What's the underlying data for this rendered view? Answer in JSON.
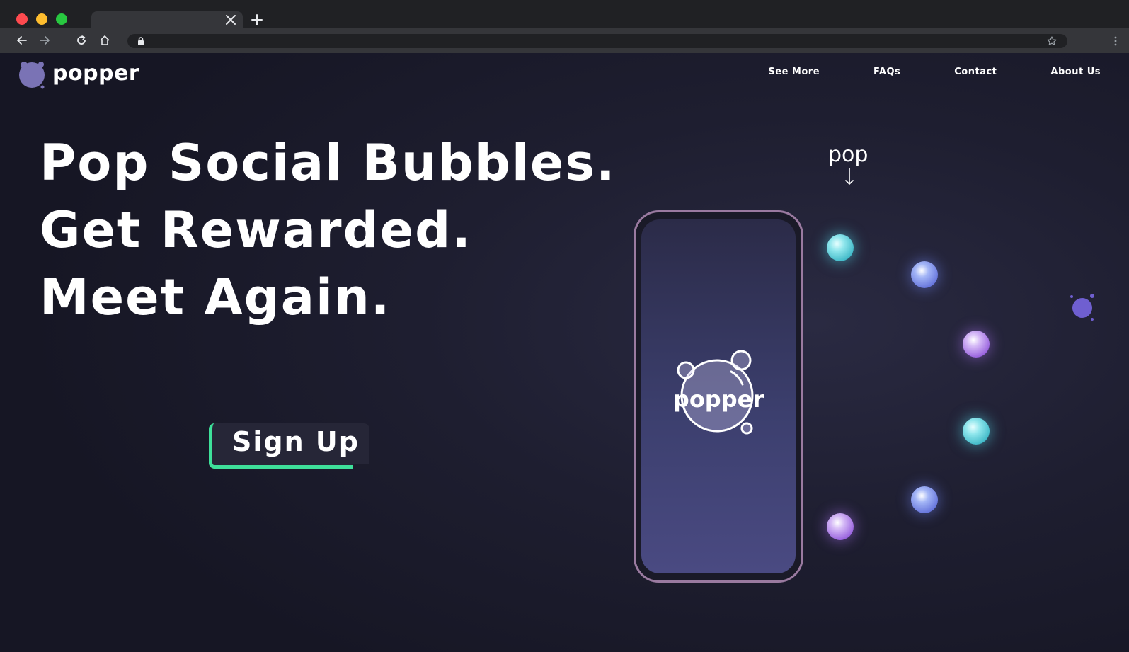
{
  "browser": {
    "tab_close_icon": "close-icon",
    "new_tab_icon": "plus-icon",
    "back_icon": "arrow-left-icon",
    "forward_icon": "arrow-right-icon",
    "reload_icon": "reload-icon",
    "home_icon": "home-icon",
    "lock_icon": "lock-icon",
    "bookmark_icon": "star-icon",
    "menu_icon": "more-vertical-icon"
  },
  "site": {
    "logo_text": "popper",
    "nav": [
      {
        "label": "See More"
      },
      {
        "label": "FAQs"
      },
      {
        "label": "Contact"
      },
      {
        "label": "About Us"
      }
    ]
  },
  "hero": {
    "lines": [
      "Pop Social Bubbles.",
      "Get Rewarded.",
      "Meet Again."
    ],
    "cta_label": "Sign Up"
  },
  "phone": {
    "logo_text": "popper"
  },
  "graphic": {
    "pop_label": "pop"
  },
  "colors": {
    "background": "#1a1a29",
    "accent_green": "#3ee09a",
    "bubble_teal": "#38b4c4",
    "bubble_blue": "#5967d6",
    "bubble_purple": "#8b4fd8",
    "logo_purple": "#7a73b5"
  }
}
